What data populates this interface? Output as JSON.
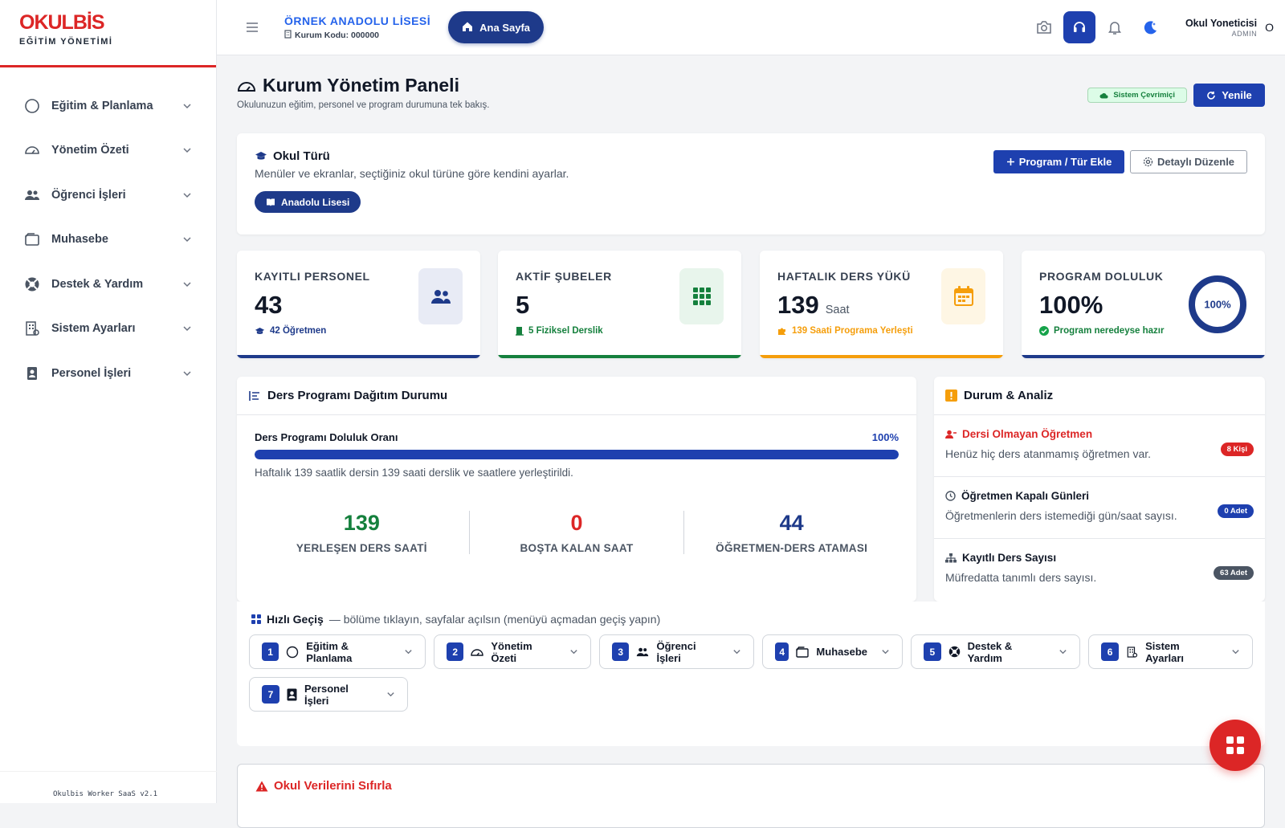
{
  "brand": {
    "name": "OKULBİS",
    "subtitle": "EĞİTİM YÖNETİMİ"
  },
  "sidebar": {
    "items": [
      {
        "label": "Eğitim & Planlama",
        "icon": "circle-icon"
      },
      {
        "label": "Yönetim Özeti",
        "icon": "gauge-icon"
      },
      {
        "label": "Öğrenci İşleri",
        "icon": "users-icon"
      },
      {
        "label": "Muhasebe",
        "icon": "wallet-icon"
      },
      {
        "label": "Destek & Yardım",
        "icon": "lifebuoy-icon"
      },
      {
        "label": "Sistem Ayarları",
        "icon": "building-icon"
      },
      {
        "label": "Personel İşleri",
        "icon": "id-badge-icon"
      }
    ],
    "footer": "Okulbis Worker SaaS v2.1"
  },
  "header": {
    "school_name": "ÖRNEK ANADOLU LİSESİ",
    "school_code": "Kurum Kodu: 000000",
    "home_label": "Ana Sayfa",
    "user_name": "Okul Yoneticisi",
    "user_role": "ADMIN",
    "user_initial": "O"
  },
  "page": {
    "title": "Kurum Yönetim Paneli",
    "subtitle": "Okulunuzun eğitim, personel ve program durumuna tek bakış.",
    "status_label": "Sistem Çevrimiçi",
    "refresh_label": "Yenile"
  },
  "school_type": {
    "title": "Okul Türü",
    "subtitle": "Menüler ve ekranlar, seçtiğiniz okul türüne göre kendini ayarlar.",
    "selected": "Anadolu Lisesi",
    "add_label": "Program / Tür Ekle",
    "edit_label": "Detaylı Düzenle"
  },
  "stats": [
    {
      "label": "KAYITLI PERSONEL",
      "value": "43",
      "unit": "",
      "foot": "42 Öğretmen",
      "color": "#1e3a8a"
    },
    {
      "label": "AKTİF ŞUBELER",
      "value": "5",
      "unit": "",
      "foot": "5 Fiziksel Derslik",
      "color": "#15803d"
    },
    {
      "label": "HAFTALIK DERS YÜKÜ",
      "value": "139",
      "unit": "Saat",
      "foot": "139 Saati Programa Yerleşti",
      "color": "#f59e0b"
    },
    {
      "label": "PROGRAM DOLULUK",
      "value": "100%",
      "unit": "",
      "foot": "Program neredeyse hazır",
      "color": "#1e3a8a",
      "ring_label": "100%",
      "ring_fraction": 1.0
    }
  ],
  "distribution": {
    "title": "Ders Programı Dağıtım Durumu",
    "progress_label": "Ders Programı Doluluk Oranı",
    "progress_value": "100%",
    "progress_fraction": 1.0,
    "note": "Haftalık 139 saatlik dersin 139 saati derslik ve saatlere yerleştirildi.",
    "metrics": [
      {
        "value": "139",
        "label": "YERLEŞEN DERS SAATİ",
        "color": "#15803d"
      },
      {
        "value": "0",
        "label": "BOŞTA KALAN SAAT",
        "color": "#dc2626"
      },
      {
        "value": "44",
        "label": "ÖĞRETMEN-DERS ATAMASI",
        "color": "#1e3a8a"
      }
    ]
  },
  "analysis": {
    "title": "Durum & Analiz",
    "items": [
      {
        "title": "Dersi Olmayan Öğretmen",
        "desc": "Henüz hiç ders atanmamış öğretmen var.",
        "badge": "8 Kişi",
        "badge_color": "#dc2626",
        "title_color": "#dc2626"
      },
      {
        "title": "Öğretmen Kapalı Günleri",
        "desc": "Öğretmenlerin ders istemediği gün/saat sayısı.",
        "badge": "0 Adet",
        "badge_color": "#1e40af",
        "title_color": "#111827"
      },
      {
        "title": "Kayıtlı Ders Sayısı",
        "desc": "Müfredatta tanımlı ders sayısı.",
        "badge": "63 Adet",
        "badge_color": "#4b5563",
        "title_color": "#111827"
      }
    ]
  },
  "quick": {
    "title": "Hızlı Geçiş",
    "hint": "— bölüme tıklayın, sayfalar açılsın (menüyü açmadan geçiş yapın)",
    "items": [
      {
        "num": "1",
        "label": "Eğitim & Planlama"
      },
      {
        "num": "2",
        "label": "Yönetim Özeti"
      },
      {
        "num": "3",
        "label": "Öğrenci İşleri"
      },
      {
        "num": "4",
        "label": "Muhasebe"
      },
      {
        "num": "5",
        "label": "Destek & Yardım"
      },
      {
        "num": "6",
        "label": "Sistem Ayarları"
      },
      {
        "num": "7",
        "label": "Personel İşleri"
      }
    ]
  },
  "reset": {
    "title": "Okul Verilerini Sıfırla"
  }
}
